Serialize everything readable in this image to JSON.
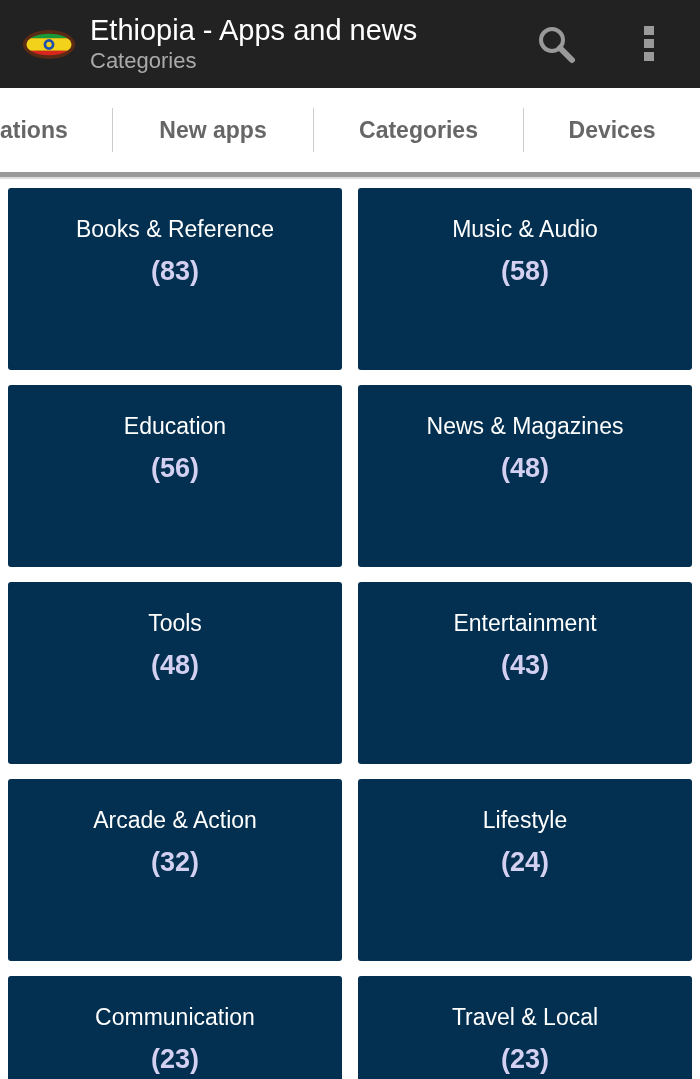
{
  "app_bar": {
    "title": "Ethiopia - Apps and news",
    "subtitle": "Categories"
  },
  "tabs": [
    {
      "label": "ations"
    },
    {
      "label": "New apps"
    },
    {
      "label": "Categories"
    },
    {
      "label": "Devices"
    }
  ],
  "categories": [
    {
      "name": "Books & Reference",
      "count": "(83)"
    },
    {
      "name": "Music & Audio",
      "count": "(58)"
    },
    {
      "name": "Education",
      "count": "(56)"
    },
    {
      "name": "News & Magazines",
      "count": "(48)"
    },
    {
      "name": "Tools",
      "count": "(48)"
    },
    {
      "name": "Entertainment",
      "count": "(43)"
    },
    {
      "name": "Arcade & Action",
      "count": "(32)"
    },
    {
      "name": "Lifestyle",
      "count": "(24)"
    },
    {
      "name": "Communication",
      "count": "(23)"
    },
    {
      "name": "Travel & Local",
      "count": "(23)"
    }
  ]
}
